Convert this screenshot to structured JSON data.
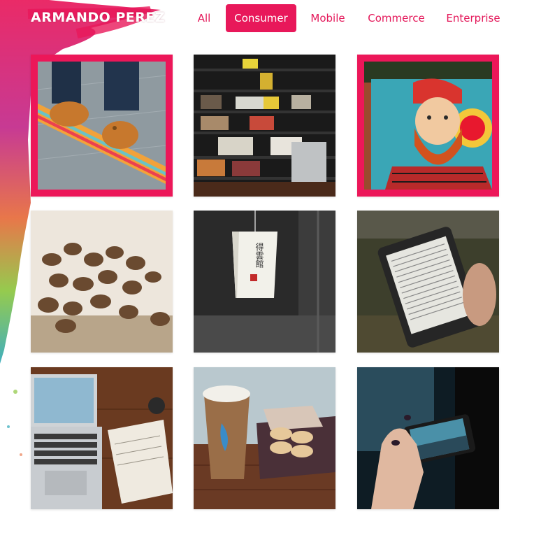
{
  "brand": {
    "name": "ARMANDO PEREZ"
  },
  "accent": "#e8185a",
  "nav": {
    "items": [
      {
        "label": "All",
        "active": false
      },
      {
        "label": "Consumer",
        "active": true
      },
      {
        "label": "Mobile",
        "active": false
      },
      {
        "label": "Commerce",
        "active": false
      },
      {
        "label": "Enterprise",
        "active": false
      }
    ]
  },
  "gallery": {
    "tiles": [
      {
        "subject": "skateboard-sneakers-photo",
        "selected": true
      },
      {
        "subject": "bookshelf-photo",
        "selected": false
      },
      {
        "subject": "bearded-man-mural-photo",
        "selected": true
      },
      {
        "subject": "coffee-beans-photo",
        "selected": false
      },
      {
        "subject": "paper-lantern-photo",
        "selected": false
      },
      {
        "subject": "ereader-photo",
        "selected": false
      },
      {
        "subject": "laptop-notebook-desk-photo",
        "selected": false
      },
      {
        "subject": "coffee-cup-macarons-photo",
        "selected": false
      },
      {
        "subject": "smartphone-in-hand-photo",
        "selected": false
      }
    ]
  },
  "lantern_text": "得雲館"
}
